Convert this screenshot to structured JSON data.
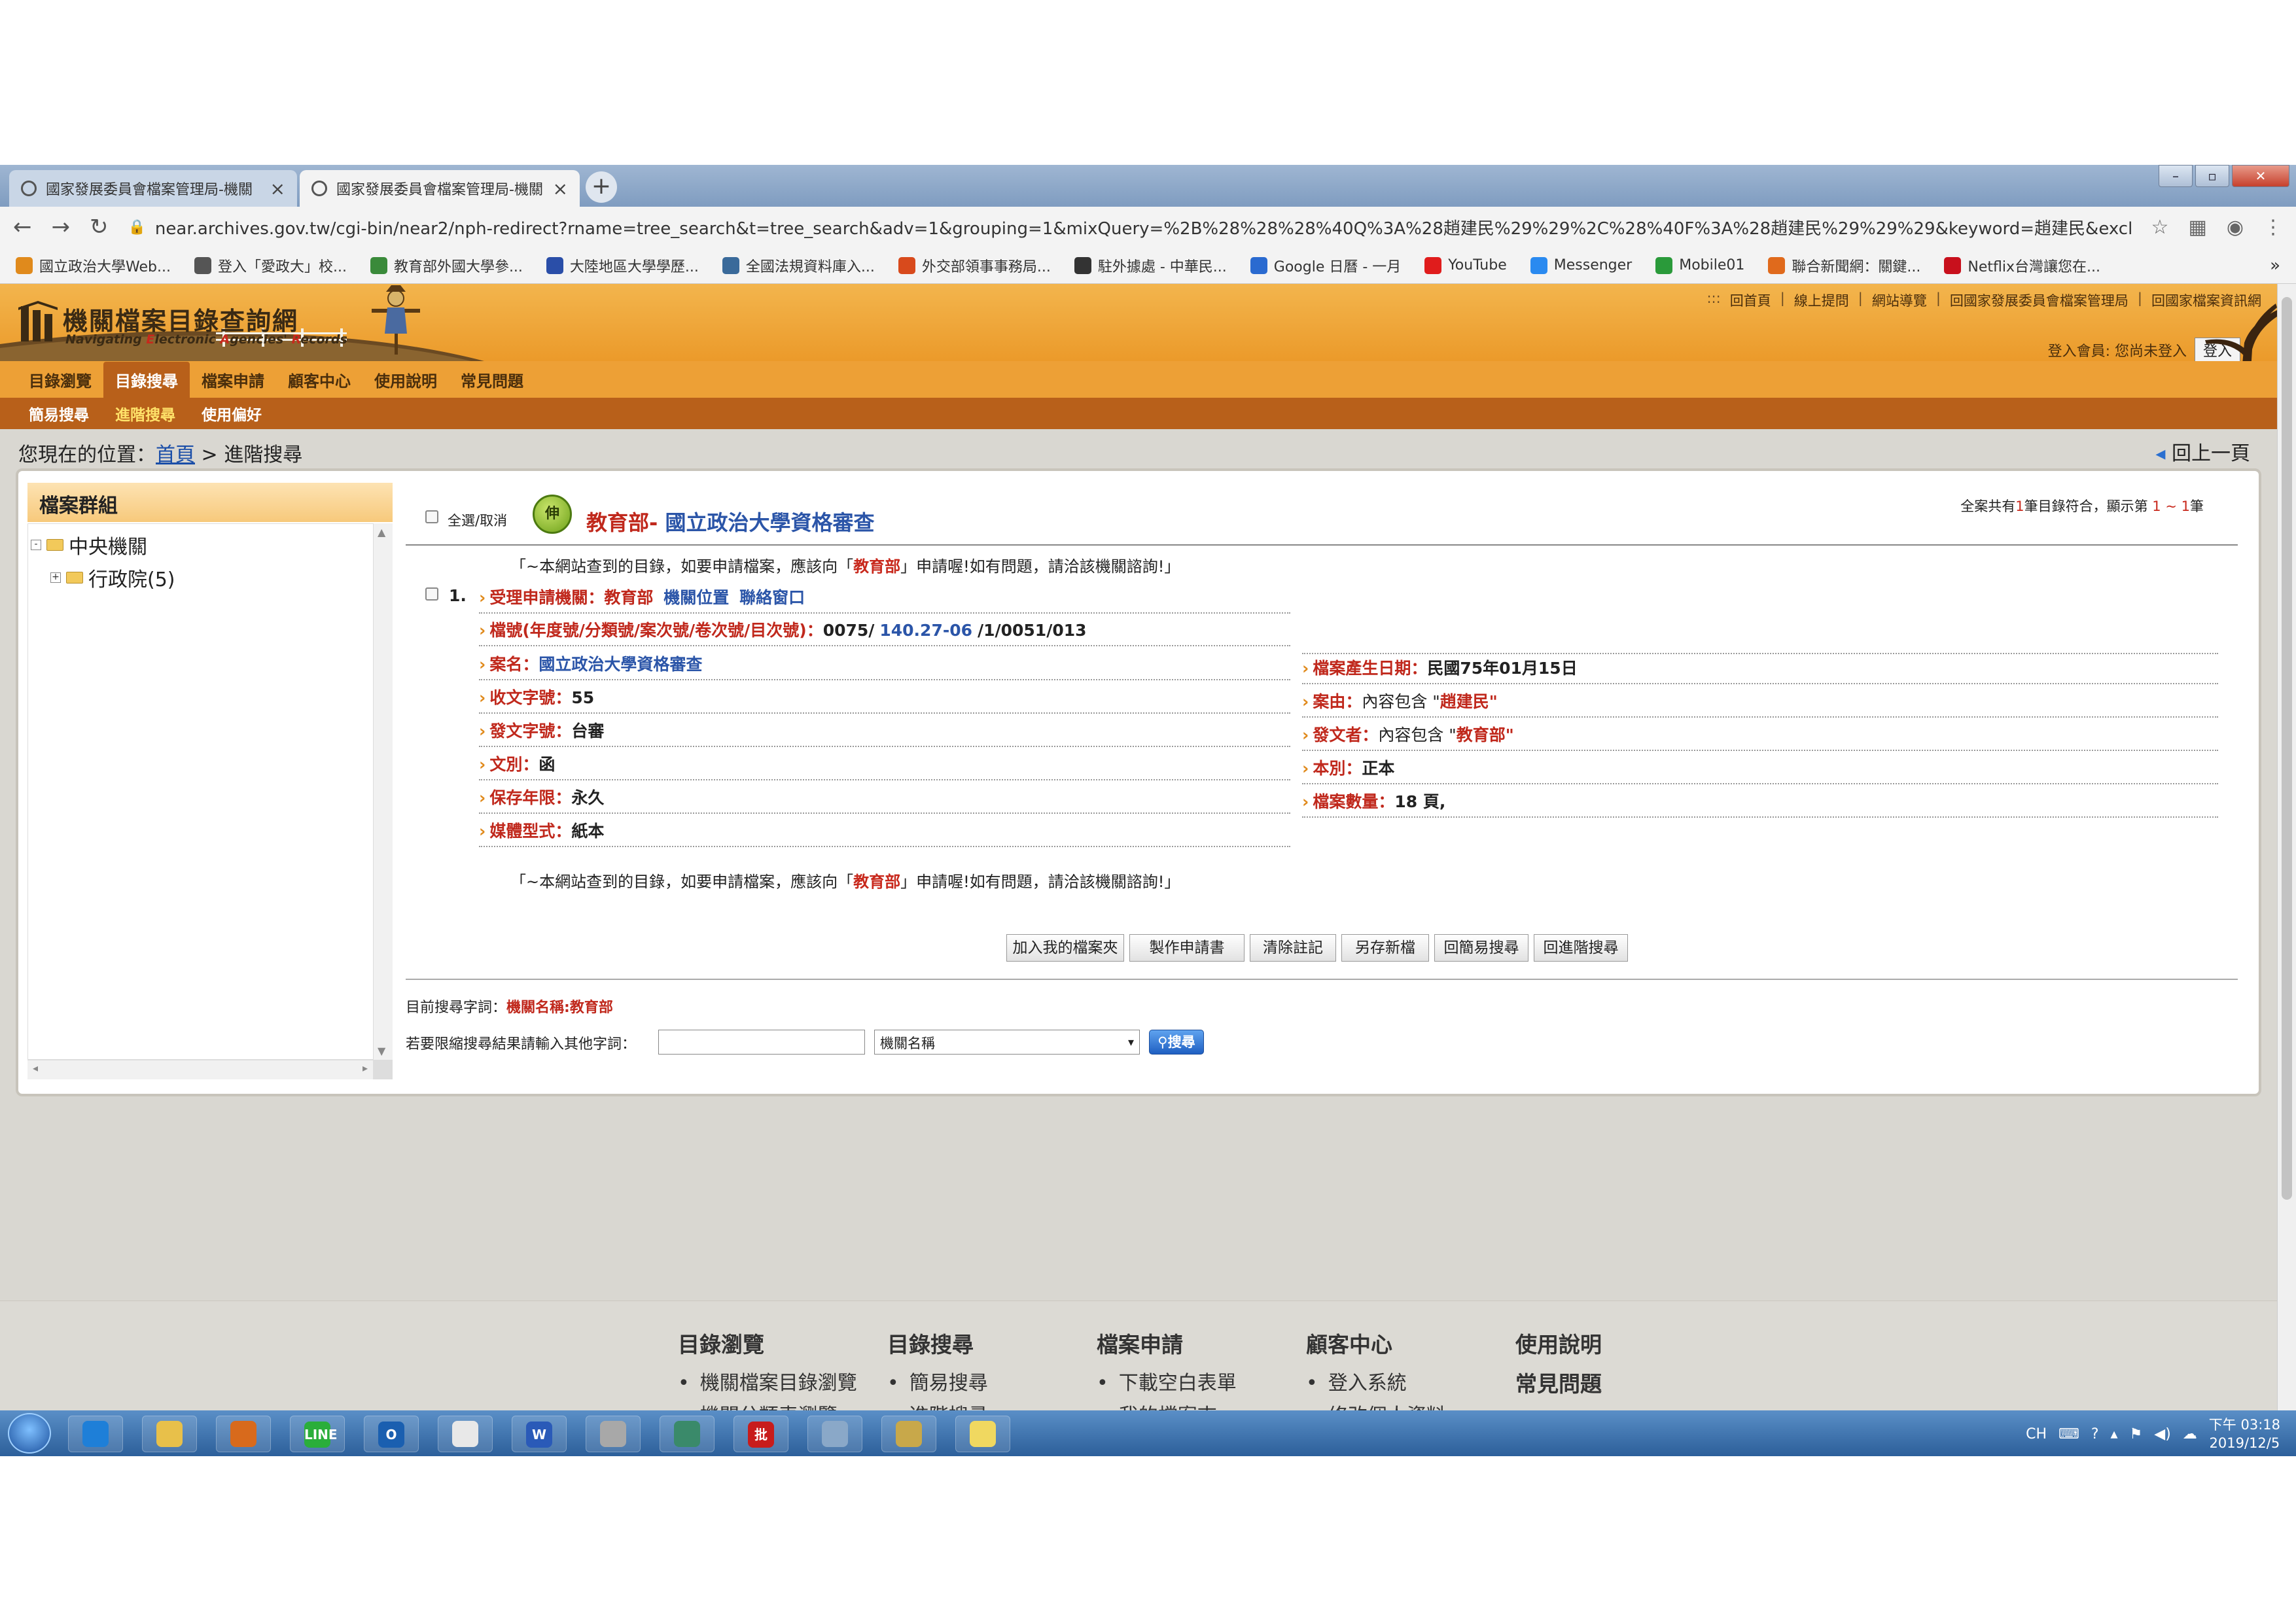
{
  "browser": {
    "tabs": [
      {
        "title": "國家發展委員會檔案管理局-機關",
        "active": false
      },
      {
        "title": "國家發展委員會檔案管理局-機關",
        "active": true
      }
    ],
    "url": "near.archives.gov.tw/cgi-bin/near2/nph-redirect?rname=tree_search&t=tree_search&adv=1&grouping=1&mixQuery=%2B%28%28%28%40Q%3A%28趙建民%29%29%2C%28%40F%3A%28趙建民%29%29%29&keyword=趙建民&excludeWord=&c...",
    "bookmarks": [
      {
        "label": "國立政治大學Web...",
        "icon": "nccu-icon",
        "color": "#e08a1c"
      },
      {
        "label": "登入「愛政大」校...",
        "icon": "globe-icon",
        "color": "#555555"
      },
      {
        "label": "教育部外國大學參...",
        "icon": "moe-icon",
        "color": "#3a8a3a"
      },
      {
        "label": "大陸地區大學學歷...",
        "icon": "china-univ-icon",
        "color": "#2a4ea8"
      },
      {
        "label": "全國法規資料庫入...",
        "icon": "law-icon",
        "color": "#3a6a9a"
      },
      {
        "label": "外交部領事事務局...",
        "icon": "boca-icon",
        "color": "#d84a1c"
      },
      {
        "label": "駐外據處 - 中華民...",
        "icon": "mofa-icon",
        "color": "#333333"
      },
      {
        "label": "Google 日曆 - 一月",
        "icon": "calendar-icon",
        "color": "#2a6ad0"
      },
      {
        "label": "YouTube",
        "icon": "youtube-icon",
        "color": "#e01c1c"
      },
      {
        "label": "Messenger",
        "icon": "messenger-icon",
        "color": "#2a8af0"
      },
      {
        "label": "Mobile01",
        "icon": "mobile01-icon",
        "color": "#2a9a3a"
      },
      {
        "label": "聯合新聞網：關鍵...",
        "icon": "udn-icon",
        "color": "#e06a1c"
      },
      {
        "label": "Netflix台灣讓您在...",
        "icon": "netflix-icon",
        "color": "#c8101c"
      }
    ],
    "more_bookmarks": "»"
  },
  "site": {
    "logo_title": "機關檔案目錄查詢網",
    "logo_sub": [
      "Navigating ",
      "E",
      "lectronic ",
      "A",
      "gencies' ",
      "R",
      "ecords"
    ],
    "top_links": [
      "回首頁",
      "線上提問",
      "網站導覽",
      "回國家發展委員會檔案管理局",
      "回國家檔案資訊網"
    ],
    "top_links_prefix": ":::",
    "login_text": "登入會員: 您尚未登入",
    "login_button": "登入",
    "main_nav": [
      "目錄瀏覽",
      "目錄搜尋",
      "檔案申請",
      "顧客中心",
      "使用說明",
      "常見問題"
    ],
    "main_nav_active": 1,
    "sub_nav": [
      "簡易搜尋",
      "進階搜尋",
      "使用偏好"
    ],
    "sub_nav_active": 1,
    "breadcrumb_prefix": "您現在的位置：",
    "breadcrumb_home": "首頁",
    "breadcrumb_sep": ">",
    "breadcrumb_current": "進階搜尋",
    "back_link": "回上一頁"
  },
  "left_pane": {
    "title": "檔案群組",
    "tree": [
      {
        "label": "中央機關",
        "level": 0,
        "expander": "-"
      },
      {
        "label": "行政院(5)",
        "level": 1,
        "expander": "+"
      }
    ]
  },
  "results": {
    "select_all_label": "全選/取消",
    "org_badge": "伸",
    "org_name": "教育部",
    "org_sep": "-",
    "case_title": "國立政治大學資格審查",
    "summary": {
      "prefix": "全案共有",
      "count": "1",
      "mid": "筆目錄符合，顯示第",
      "from": "1",
      "tilde": "~",
      "to": "1",
      "suffix": "筆"
    },
    "notice": {
      "before": "「~本網站查到的目錄，如要申請檔案，應該向「",
      "org": "教育部",
      "after": "」申請喔!如有問題，請洽該機關諮詢!」"
    },
    "item_number": "1.",
    "agency_label": "受理申請機關：",
    "agency_value": "教育部",
    "agency_links": [
      "機關位置",
      "聯絡窗口"
    ],
    "archive_no_label": "檔號(年度號/分類號/案次號/卷次號/目次號)：",
    "archive_no_parts": [
      "0075/",
      "140.27-06",
      "/1/0051/013"
    ],
    "left_fields": [
      {
        "label": "案名：",
        "value": "國立政治大學資格審查",
        "style": "blue"
      },
      {
        "label": "收文字號：",
        "value": "55",
        "style": "bold"
      },
      {
        "label": "發文字號：",
        "value": "台審",
        "style": "bold"
      },
      {
        "label": "文別：",
        "value": "函",
        "style": "bold"
      },
      {
        "label": "保存年限：",
        "value": "永久",
        "style": "bold"
      },
      {
        "label": "媒體型式：",
        "value": "紙本",
        "style": "bold"
      }
    ],
    "right_fields": [
      {
        "label": "檔案產生日期：",
        "value": "民國75年01月15日",
        "prefix": "",
        "hl": "",
        "suffix": ""
      },
      {
        "label": "案由：",
        "value": "",
        "prefix": "內容包含 \"",
        "hl": "趙建民",
        "suffix": "\""
      },
      {
        "label": "發文者：",
        "value": "",
        "prefix": "內容包含 \"",
        "hl": "教育部",
        "suffix": "\""
      },
      {
        "label": "本別：",
        "value": "正本",
        "prefix": "",
        "hl": "",
        "suffix": ""
      },
      {
        "label": "檔案數量：",
        "value": "18 頁,",
        "prefix": "",
        "hl": "",
        "suffix": ""
      }
    ],
    "buttons": [
      "加入我的檔案夾",
      "製作申請書",
      "清除註記",
      "另存新檔",
      "回簡易搜尋",
      "回進階搜尋"
    ],
    "current_query_label": "目前搜尋字詞：",
    "current_query_value": "機關名稱:教育部",
    "refine_label": "若要限縮搜尋結果請輸入其他字詞：",
    "refine_input_value": "",
    "refine_field_selected": "機關名稱",
    "search_button": "搜尋"
  },
  "footer": {
    "columns": [
      {
        "head": "目錄瀏覽",
        "items": [
          "機關檔案目錄瀏覽",
          "機關分類表瀏覽"
        ]
      },
      {
        "head": "目錄搜尋",
        "items": [
          "簡易搜尋",
          "進階搜尋"
        ]
      },
      {
        "head": "檔案申請",
        "items": [
          "下載空白表單",
          "我的檔案夾"
        ]
      },
      {
        "head": "顧客中心",
        "items": [
          "登入系統",
          "修改個人資料"
        ]
      },
      {
        "head": "使用說明",
        "items": []
      }
    ],
    "extra_head": "常見問題"
  },
  "taskbar": {
    "apps": [
      "ie-icon",
      "explorer-icon",
      "media-player-icon",
      "line-icon",
      "outlook-icon",
      "chrome-icon",
      "word-icon",
      "calculator-icon",
      "remote-desktop-icon",
      "batch-icon",
      "notebook-icon",
      "paint-icon",
      "sticky-notes-icon"
    ],
    "app_labels": {
      "line-icon": "LINE",
      "word-icon": "W",
      "outlook-icon": "O",
      "batch-icon": "批"
    },
    "ime": "CH",
    "time": "下午 03:18",
    "date": "2019/12/5"
  },
  "colors": {
    "header_orange": "#eb9a2a",
    "nav_brown": "#b8601a",
    "link_blue": "#2b55a8",
    "label_red": "#c0281c"
  }
}
